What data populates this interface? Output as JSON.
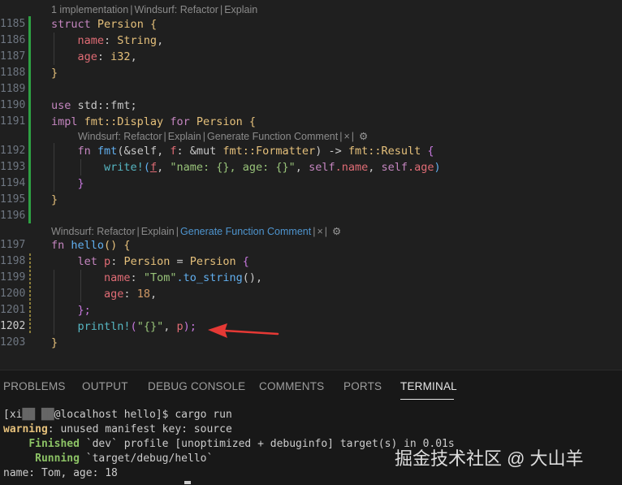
{
  "editor": {
    "codelens": [
      {
        "parts": [
          "1 implementation",
          "Windsurf: Refactor",
          "Explain"
        ]
      },
      {
        "parts": [
          "Windsurf: Refactor",
          "Explain",
          "Generate Function Comment",
          "×",
          "⚙"
        ]
      },
      {
        "parts": [
          "Windsurf: Refactor",
          "Explain",
          "Generate Function Comment",
          "×",
          "⚙"
        ]
      }
    ],
    "line_numbers": [
      "1185",
      "1186",
      "1187",
      "1188",
      "1189",
      "1190",
      "1191",
      "1192",
      "1193",
      "1194",
      "1195",
      "1196",
      "1197",
      "1198",
      "1199",
      "1200",
      "1201",
      "1202",
      "1203"
    ],
    "lines": {
      "l1185": {
        "kw": "struct",
        "name": "Persion",
        "brace": "{"
      },
      "l1186": {
        "field": "name",
        "type": "String"
      },
      "l1187": {
        "field": "age",
        "type": "i32"
      },
      "l1188": {
        "close": "}"
      },
      "l1190": {
        "kw": "use",
        "path": "std::fmt;"
      },
      "l1191": {
        "kw": "impl",
        "trait": "fmt::Display",
        "for": "for",
        "name": "Persion",
        "brace": "{"
      },
      "l1192": {
        "kw": "fn",
        "fname": "fmt",
        "params_pre": "(&self, ",
        "p": "f",
        "params_mid": ": &mut ",
        "ty": "fmt::Formatter",
        "arrow": ") -> ",
        "ret": "fmt::Result",
        "brace": " {"
      },
      "l1193": {
        "mac": "write!",
        "pre": "(",
        "p": "f",
        "str": "\"name: {}, age: {}\"",
        "self1": "self",
        "f1": ".name",
        "self2": "self",
        "f2": ".age",
        "end": ")"
      },
      "l1194": {
        "close": "}"
      },
      "l1195": {
        "close": "}"
      },
      "l1197": {
        "kw": "fn",
        "fname": "hello",
        "rest": "() {"
      },
      "l1198": {
        "kw": "let",
        "var": "p",
        "type": "Persion",
        "eq": " = ",
        "ctor": "Persion",
        "brace": " {"
      },
      "l1199": {
        "field": "name",
        "str": "\"Tom\"",
        "call": ".to_string",
        "rest": "(),"
      },
      "l1200": {
        "field": "age",
        "num": "18",
        "rest": ","
      },
      "l1201": {
        "close": "};"
      },
      "l1202": {
        "mac": "println!",
        "pre": "(",
        "str": "\"{}\"",
        "mid": ", ",
        "var": "p",
        "end": ");"
      },
      "l1203": {
        "close": "}"
      }
    },
    "active_line": "1202"
  },
  "panel": {
    "tabs": [
      "PROBLEMS",
      "OUTPUT",
      "DEBUG CONSOLE",
      "COMMENTS",
      "PORTS",
      "TERMINAL"
    ],
    "active_tab": "TERMINAL",
    "terminal": {
      "prompt": "[xi",
      "redacted": "██ ██",
      "prompt_rest": "@localhost hello]$ cargo run",
      "warning_label": "warning",
      "warning_text": ": unused manifest key: source",
      "finished_label": "Finished",
      "finished_text": " `dev` profile [unoptimized + debuginfo] target(s) in 0.01s",
      "running_label": "Running",
      "running_text": " `target/debug/hello`",
      "output": "name: Tom, age: 18"
    }
  },
  "watermark": "掘金技术社区 @ 大山羊"
}
